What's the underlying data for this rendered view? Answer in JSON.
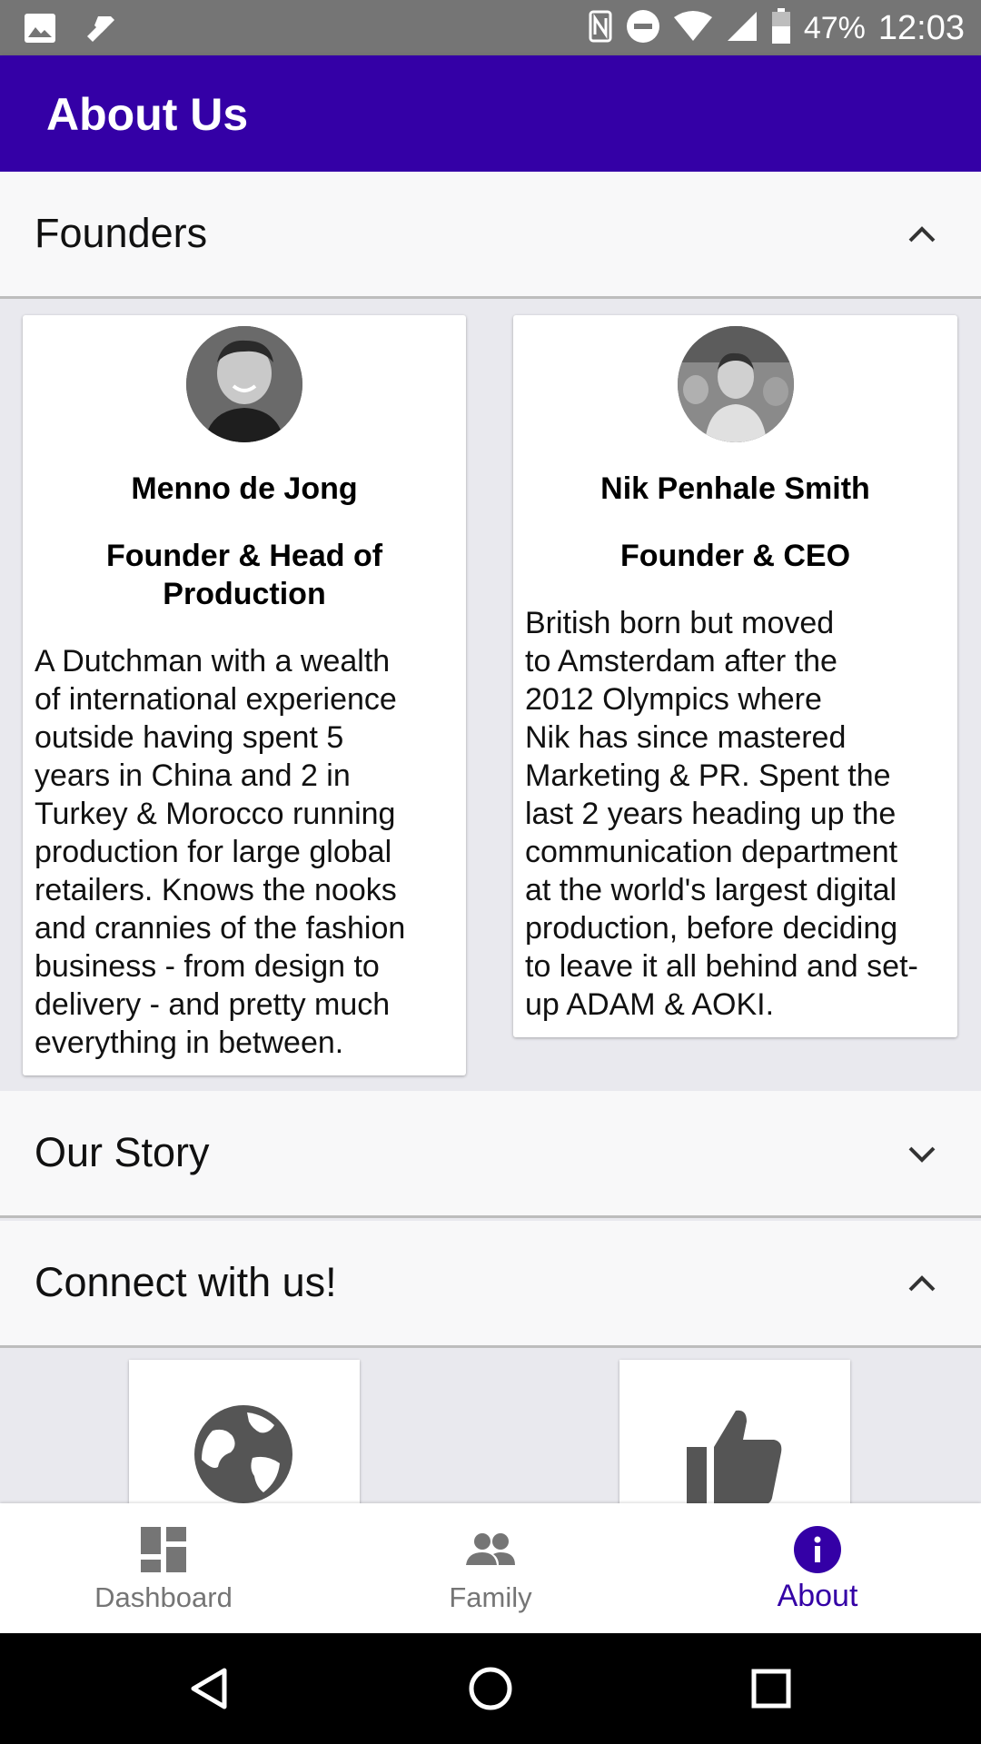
{
  "status_bar": {
    "battery": "47%",
    "time": "12:03"
  },
  "app_bar": {
    "title": "About Us"
  },
  "sections": {
    "founders": {
      "title": "Founders",
      "expanded": true
    },
    "our_story": {
      "title": "Our Story",
      "expanded": false
    },
    "connect": {
      "title": "Connect with us!",
      "expanded": true
    }
  },
  "founders": [
    {
      "name": "Menno de Jong",
      "role": "Founder & Head of Production",
      "bio_lines": [
        "A Dutchman with a wealth",
        "of international experience",
        "outside having spent 5",
        "years in China and 2 in",
        "Turkey & Morocco running",
        "production for large global",
        "retailers. Knows the nooks",
        "and crannies of the fashion",
        "business - from design to",
        "delivery - and pretty much",
        "everything in between."
      ]
    },
    {
      "name": "Nik Penhale Smith",
      "role": "Founder & CEO",
      "bio_lines": [
        "British born but moved",
        "to Amsterdam after the",
        "2012 Olympics where",
        "Nik has since mastered",
        "Marketing & PR. Spent the",
        "last 2 years heading up the",
        "communication department",
        "at the world's largest digital",
        "production, before deciding",
        "to leave it all behind and set-",
        "up ADAM & AOKI."
      ]
    }
  ],
  "connect_items": [
    {
      "icon": "globe-icon"
    },
    {
      "icon": "thumbs-up-icon"
    }
  ],
  "bottom_nav": {
    "items": [
      {
        "label": "Dashboard",
        "icon": "dashboard-icon",
        "active": false
      },
      {
        "label": "Family",
        "icon": "people-icon",
        "active": false
      },
      {
        "label": "About",
        "icon": "info-icon",
        "active": true
      }
    ]
  },
  "colors": {
    "primary": "#3400a6",
    "status_bar": "#757575",
    "background": "#e9e9ee",
    "inactive_icon": "#757575"
  }
}
